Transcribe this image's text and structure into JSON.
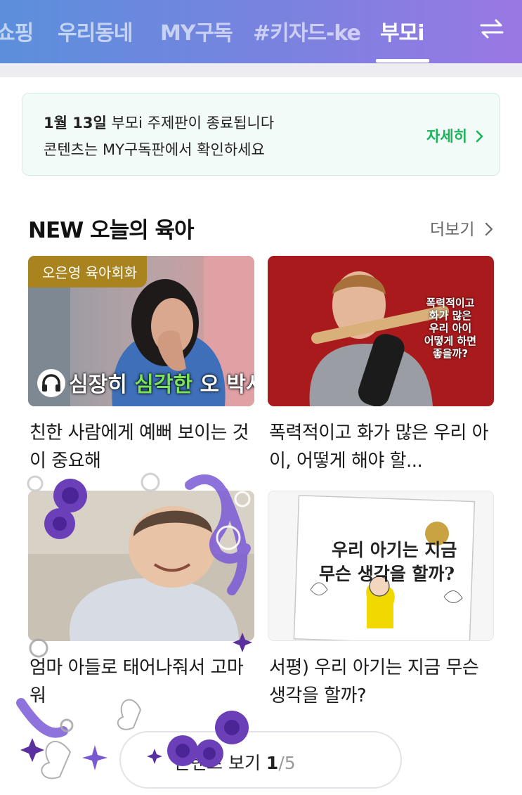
{
  "tabs": [
    {
      "label": "쇼핑",
      "active": false
    },
    {
      "label": "우리동네",
      "active": false
    },
    {
      "label": "MY구독",
      "active": false
    },
    {
      "label": "#키자드-ke",
      "active": false
    },
    {
      "label": "부모i",
      "active": true
    }
  ],
  "notice": {
    "date": "1월 13일",
    "line1_rest": " 부모i 주제판이 종료됩니다",
    "line2": "콘텐츠는 MY구독판에서 확인하세요",
    "more_label": "자세히",
    "more_icon": "chevron-right-icon"
  },
  "section": {
    "title": "NEW 오늘의 육아",
    "more_label": "더보기"
  },
  "cards": [
    {
      "title": "친한 사람에게 예뻐 보이는 것이 중요해",
      "badge": "오은영 육아회화",
      "caption_pre": "심장히 ",
      "caption_hl": "심각한",
      "caption_post": " 오 박사",
      "thumb_icon": "headphones-icon"
    },
    {
      "title": "폭력적이고 화가 많은 우리 아이, 어떻게 해야 할...",
      "overlay_text": [
        "폭력적이고",
        "화가 많은",
        "우리 아이",
        "어떻게 하면",
        "좋을까?"
      ]
    },
    {
      "title": "엄마 아들로 태어나줘서 고마워"
    },
    {
      "title": "서평) 우리 아기는 지금 무슨 생각을 할까?",
      "book_lines": [
        "우리 아기는 지금",
        "무슨 생각을 할까?"
      ]
    }
  ],
  "pager": {
    "label": "콘텐츠 보기",
    "current": "1",
    "separator": "/",
    "total": "5"
  },
  "colors": {
    "topbar_start": "#5b8fdc",
    "topbar_end": "#9a78e4",
    "accent_green": "#19b45a",
    "badge_gold": "#a8831e",
    "sticker_purple": "#6a3fb8"
  }
}
